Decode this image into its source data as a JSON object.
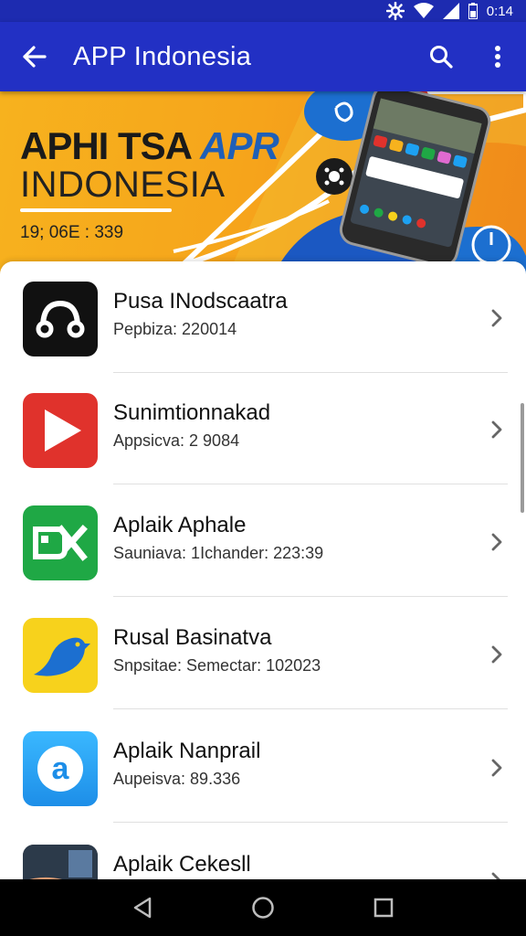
{
  "status_bar": {
    "time": "0:14",
    "icons": [
      "settings-gear-icon",
      "wifi-icon",
      "signal-icon",
      "battery-icon"
    ]
  },
  "app_bar": {
    "title": "APP Indonesia",
    "icons": [
      "back-arrow-icon",
      "search-icon",
      "more-vert-icon"
    ]
  },
  "banner": {
    "headline_main": "APHI TSA",
    "headline_accent": "APR",
    "subline": "INDONESIA",
    "meta": "19; 06E : 339"
  },
  "apps": [
    {
      "name": "Pusa INodscaatra",
      "detail": "Pepbiza: 220014",
      "icon": "headphones-app-icon",
      "color": "#111111"
    },
    {
      "name": "Sunimtionnakad",
      "detail": "Appsicva: 2 9084",
      "icon": "play-app-icon",
      "color": "#e0322c"
    },
    {
      "name": "Aplaik Aphale",
      "detail": "Sauniava: 1Ichander: 223:39",
      "icon": "dx-app-icon",
      "color": "#1fa845"
    },
    {
      "name": "Rusal Basinatva",
      "detail": "Snpsitae: Semectar: 102023",
      "icon": "bird-app-icon",
      "color": "#f7d21c"
    },
    {
      "name": "Aplaik Nanprail",
      "detail": "Aupeisva: 89.336",
      "icon": "a-letter-app-icon",
      "color": "#1da1f2"
    },
    {
      "name": "Aplaik Cekesll",
      "detail": "",
      "icon": "photo-app-icon",
      "color": "#333333"
    }
  ],
  "nav_bar": {
    "icons": [
      "nav-back-icon",
      "nav-home-icon",
      "nav-recents-icon"
    ]
  }
}
